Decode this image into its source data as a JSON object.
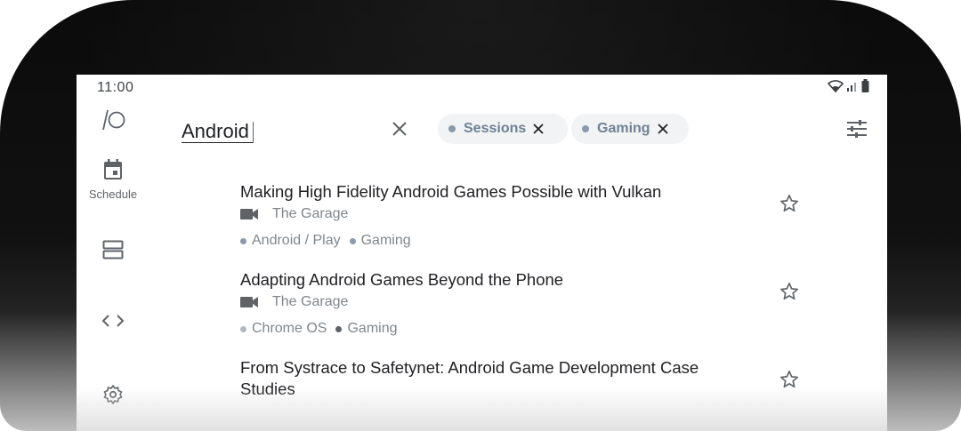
{
  "status": {
    "time": "11:00"
  },
  "rail": {
    "schedule_label": "Schedule"
  },
  "search": {
    "query": "Android"
  },
  "chips": [
    {
      "label": "Sessions"
    },
    {
      "label": "Gaming"
    }
  ],
  "sessions": [
    {
      "title": "Making High Fidelity Android Games Possible with Vulkan",
      "room": "The Garage",
      "tags": [
        "Android / Play",
        "Gaming"
      ]
    },
    {
      "title": "Adapting Android Games Beyond the Phone",
      "room": "The Garage",
      "tags": [
        "Chrome OS",
        "Gaming"
      ]
    },
    {
      "title": "From Systrace to Safetynet: Android Game Development Case Studies"
    }
  ],
  "colors": {
    "accent_tag": "#8a9aac",
    "text_primary": "#202124",
    "text_secondary": "#80868b"
  },
  "icons": {
    "wifi": "wifi-icon",
    "signal": "signal-icon",
    "battery": "battery-icon",
    "logo": "io-logo-icon",
    "schedule": "calendar-icon",
    "agenda": "agenda-icon",
    "codelabs": "code-icon",
    "settings": "gear-icon",
    "clear": "close-icon",
    "filter": "tune-icon",
    "camera": "videocam-icon",
    "star": "star-outline-icon"
  }
}
